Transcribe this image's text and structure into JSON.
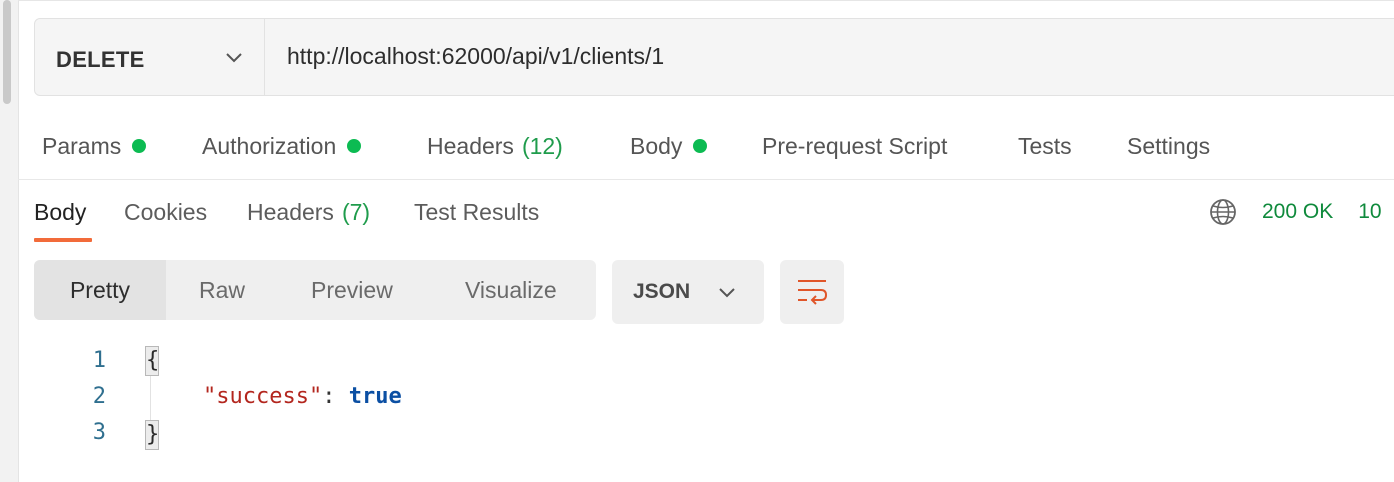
{
  "request": {
    "method": "DELETE",
    "url": "http://localhost:62000/api/v1/clients/1"
  },
  "request_tabs": [
    {
      "label": "Params",
      "dot": true
    },
    {
      "label": "Authorization",
      "dot": true
    },
    {
      "label": "Headers",
      "count": "(12)"
    },
    {
      "label": "Body",
      "dot": true
    },
    {
      "label": "Pre-request Script"
    },
    {
      "label": "Tests"
    },
    {
      "label": "Settings"
    }
  ],
  "response_tabs": [
    {
      "label": "Body",
      "active": true
    },
    {
      "label": "Cookies"
    },
    {
      "label": "Headers",
      "count": "(7)"
    },
    {
      "label": "Test Results"
    }
  ],
  "status": {
    "code": "200 OK",
    "time": "10"
  },
  "view_modes": [
    "Pretty",
    "Raw",
    "Preview",
    "Visualize"
  ],
  "selected_view": "Pretty",
  "format": "JSON",
  "code": {
    "line_numbers": [
      "1",
      "2",
      "3"
    ],
    "open_brace": "{",
    "key": "\"success\"",
    "colon": ": ",
    "value": "true",
    "close_brace": "}"
  },
  "icons": {
    "globe": "globe-icon",
    "wrap": "word-wrap-icon",
    "chevron": "chevron-down-icon"
  },
  "colors": {
    "accent": "#f26b3a",
    "status_ok": "#0f8a3c",
    "dot": "#0cbb52"
  }
}
